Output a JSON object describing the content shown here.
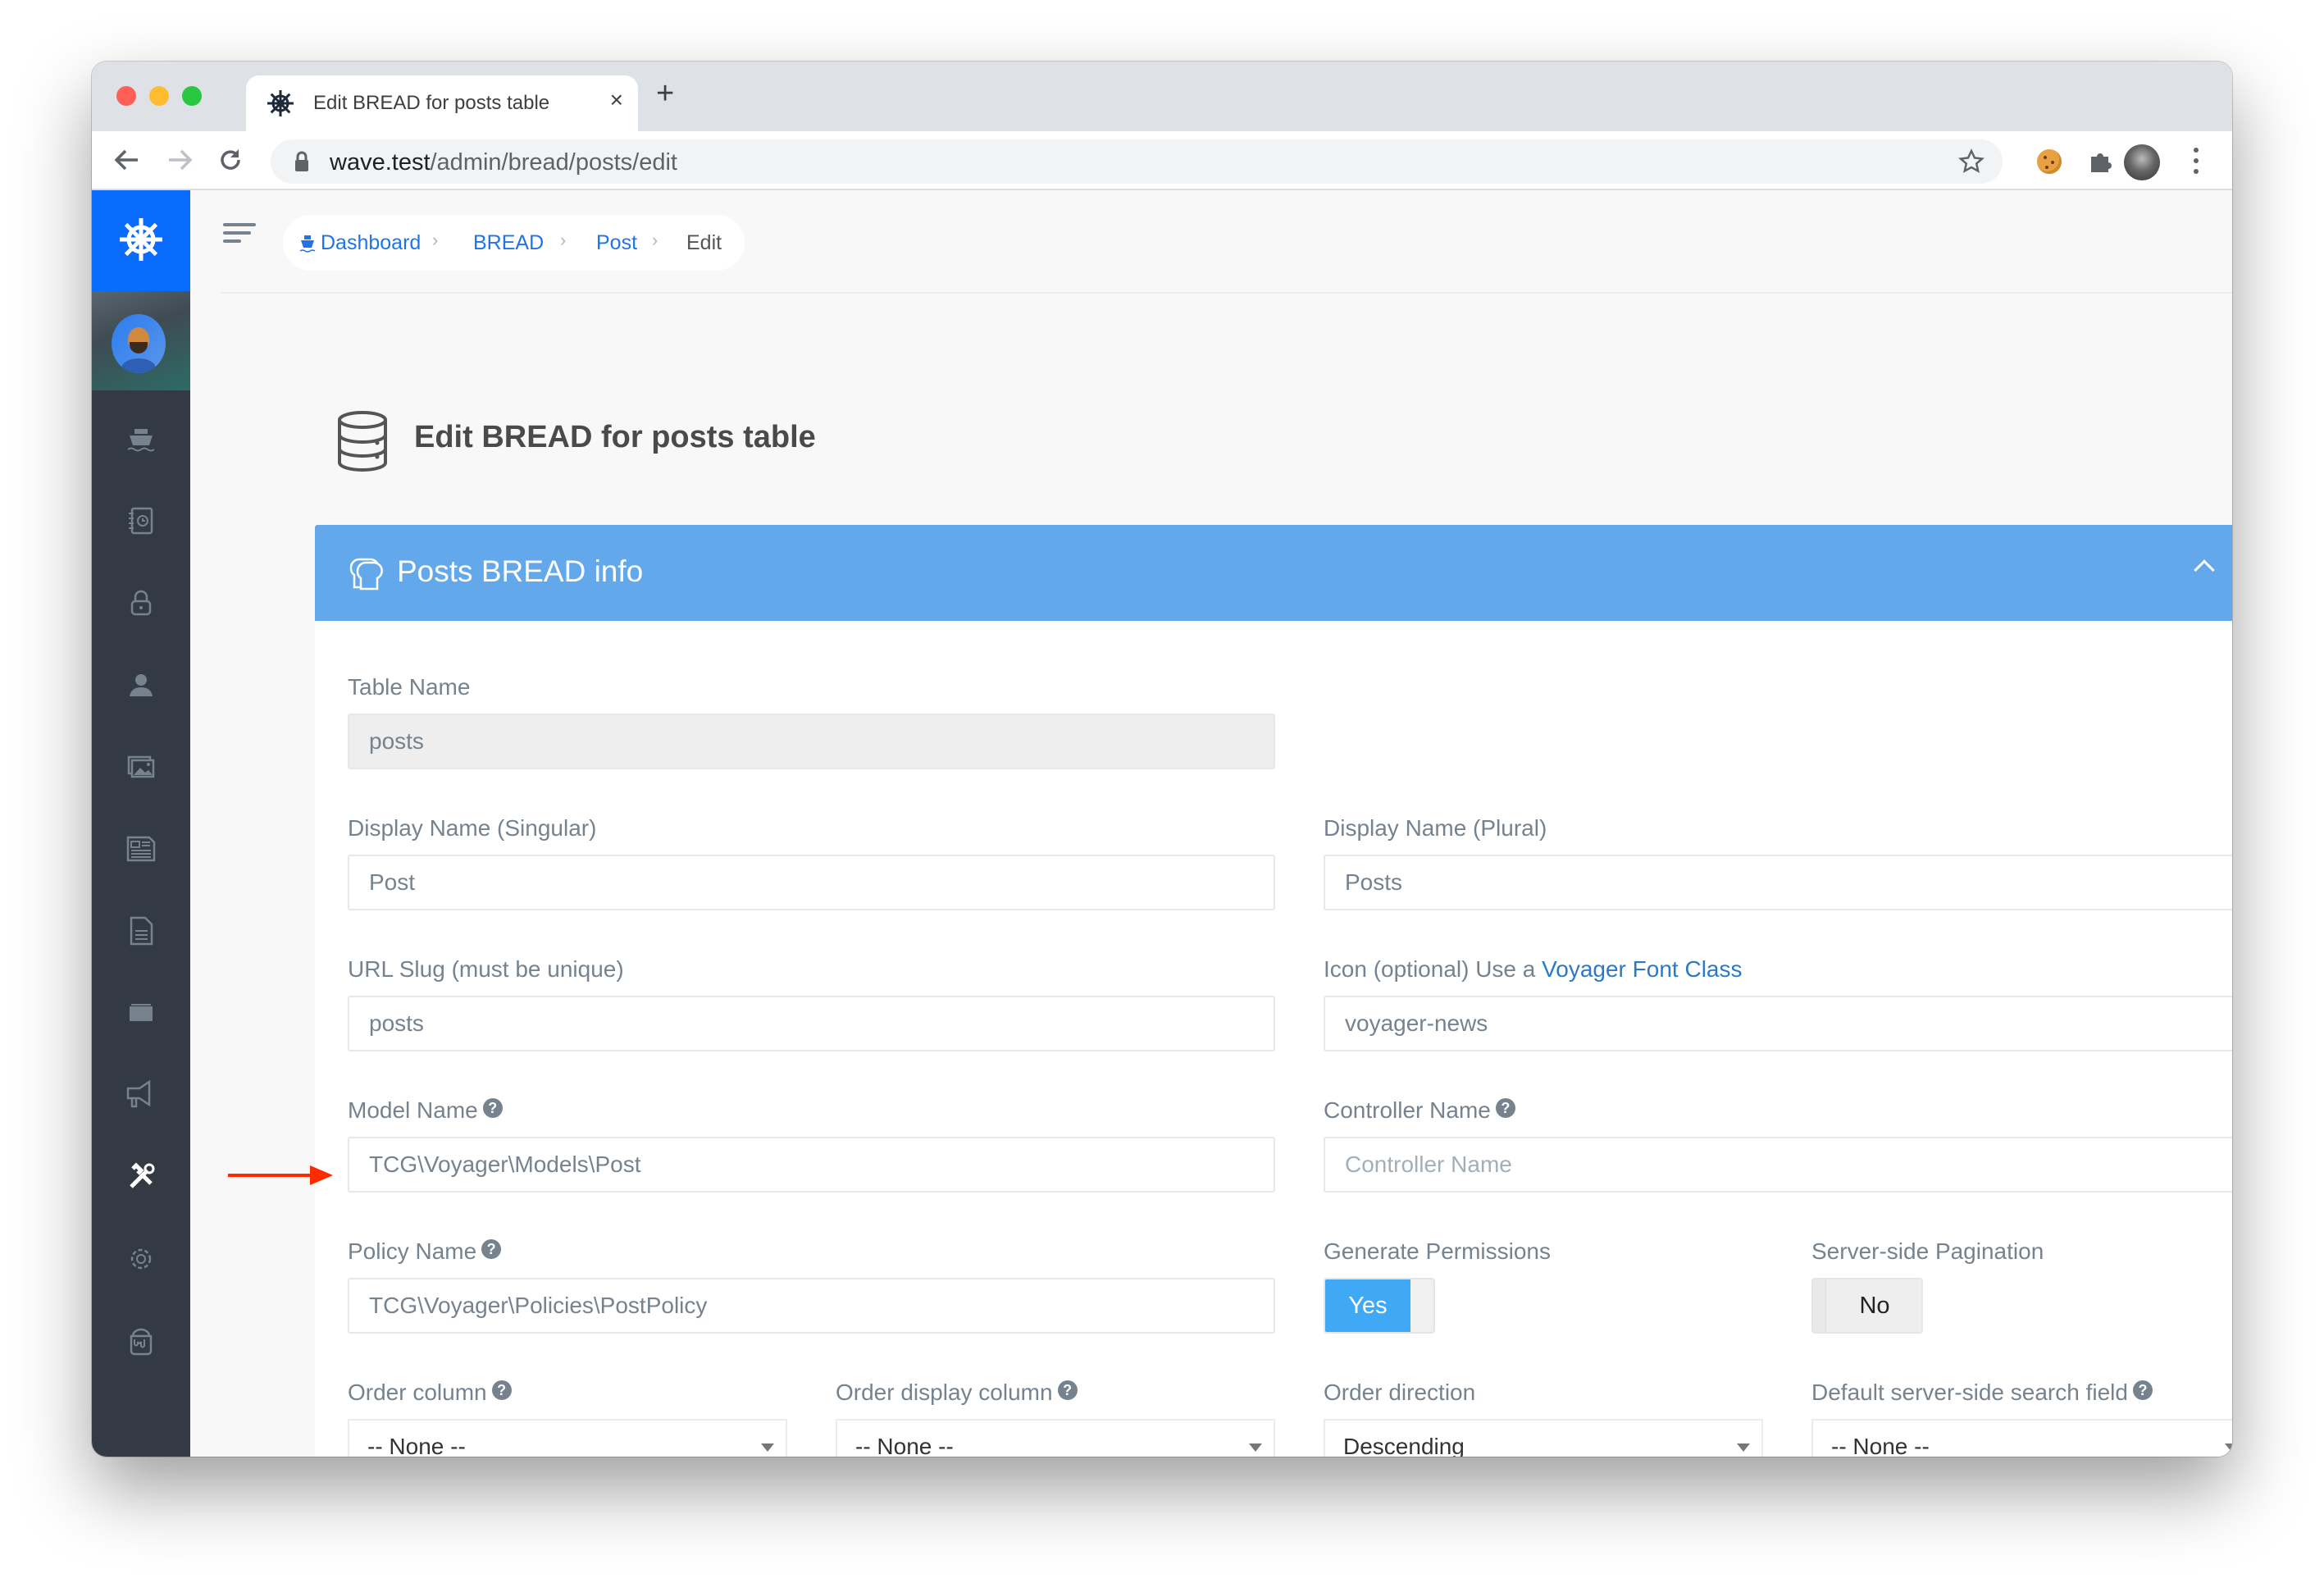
{
  "browser": {
    "tab_title": "Edit BREAD for posts table",
    "tab_close": "×",
    "new_tab": "+",
    "url_host": "wave.test",
    "url_path": "/admin/bread/posts/edit",
    "icons": [
      "back-arrow-icon",
      "forward-arrow-icon",
      "reload-icon",
      "lock-icon",
      "star-icon",
      "cookie-extension-icon",
      "puzzle-extension-icon",
      "profile-avatar-icon",
      "kebab-menu-icon"
    ]
  },
  "sidebar": {
    "items": [
      {
        "icon": "boat-icon",
        "label": "Dashboard"
      },
      {
        "icon": "compass-book-icon",
        "label": "Media"
      },
      {
        "icon": "lock-icon",
        "label": "Roles"
      },
      {
        "icon": "person-icon",
        "label": "Users"
      },
      {
        "icon": "images-icon",
        "label": "Media"
      },
      {
        "icon": "news-icon",
        "label": "Posts"
      },
      {
        "icon": "file-text-icon",
        "label": "Pages"
      },
      {
        "icon": "categories-icon",
        "label": "Categories"
      },
      {
        "icon": "megaphone-icon",
        "label": "Announcements"
      },
      {
        "icon": "tools-icon",
        "label": "Tools",
        "active": true
      },
      {
        "icon": "gear-icon",
        "label": "Settings"
      },
      {
        "icon": "paint-bucket-icon",
        "label": "Themes"
      }
    ]
  },
  "header": {
    "breadcrumbs": [
      {
        "label": "Dashboard",
        "link": true
      },
      {
        "label": "BREAD",
        "link": true
      },
      {
        "label": "Post",
        "link": true
      },
      {
        "label": "Edit",
        "link": false
      }
    ],
    "separator": "›"
  },
  "page": {
    "title": "Edit BREAD for posts table"
  },
  "panel": {
    "title": "Posts BREAD info",
    "colors": {
      "header": "#62a8ea",
      "toggle_on": "#3fa9f5",
      "sidebar": "#343a44",
      "logo": "#0a6cff"
    }
  },
  "form": {
    "table_name": {
      "label": "Table Name",
      "value": "posts"
    },
    "display_singular": {
      "label": "Display Name (Singular)",
      "value": "Post"
    },
    "display_plural": {
      "label": "Display Name (Plural)",
      "value": "Posts"
    },
    "url_slug": {
      "label": "URL Slug (must be unique)",
      "value": "posts"
    },
    "icon": {
      "label_prefix": "Icon (optional) Use a ",
      "label_link": "Voyager Font Class",
      "value": "voyager-news"
    },
    "model_name": {
      "label": "Model Name",
      "value": "TCG\\Voyager\\Models\\Post"
    },
    "controller_name": {
      "label": "Controller Name",
      "value": "",
      "placeholder": "Controller Name"
    },
    "policy_name": {
      "label": "Policy Name",
      "value": "TCG\\Voyager\\Policies\\PostPolicy"
    },
    "generate_permissions": {
      "label": "Generate Permissions",
      "value": "Yes"
    },
    "server_side_pagination": {
      "label": "Server-side Pagination",
      "value": "No"
    },
    "order_column": {
      "label": "Order column",
      "value": "-- None --"
    },
    "order_display_column": {
      "label": "Order display column",
      "value": "-- None --"
    },
    "order_direction": {
      "label": "Order direction",
      "value": "Descending"
    },
    "default_search_field": {
      "label": "Default server-side search field",
      "value": "-- None --"
    },
    "help_glyph": "?"
  }
}
